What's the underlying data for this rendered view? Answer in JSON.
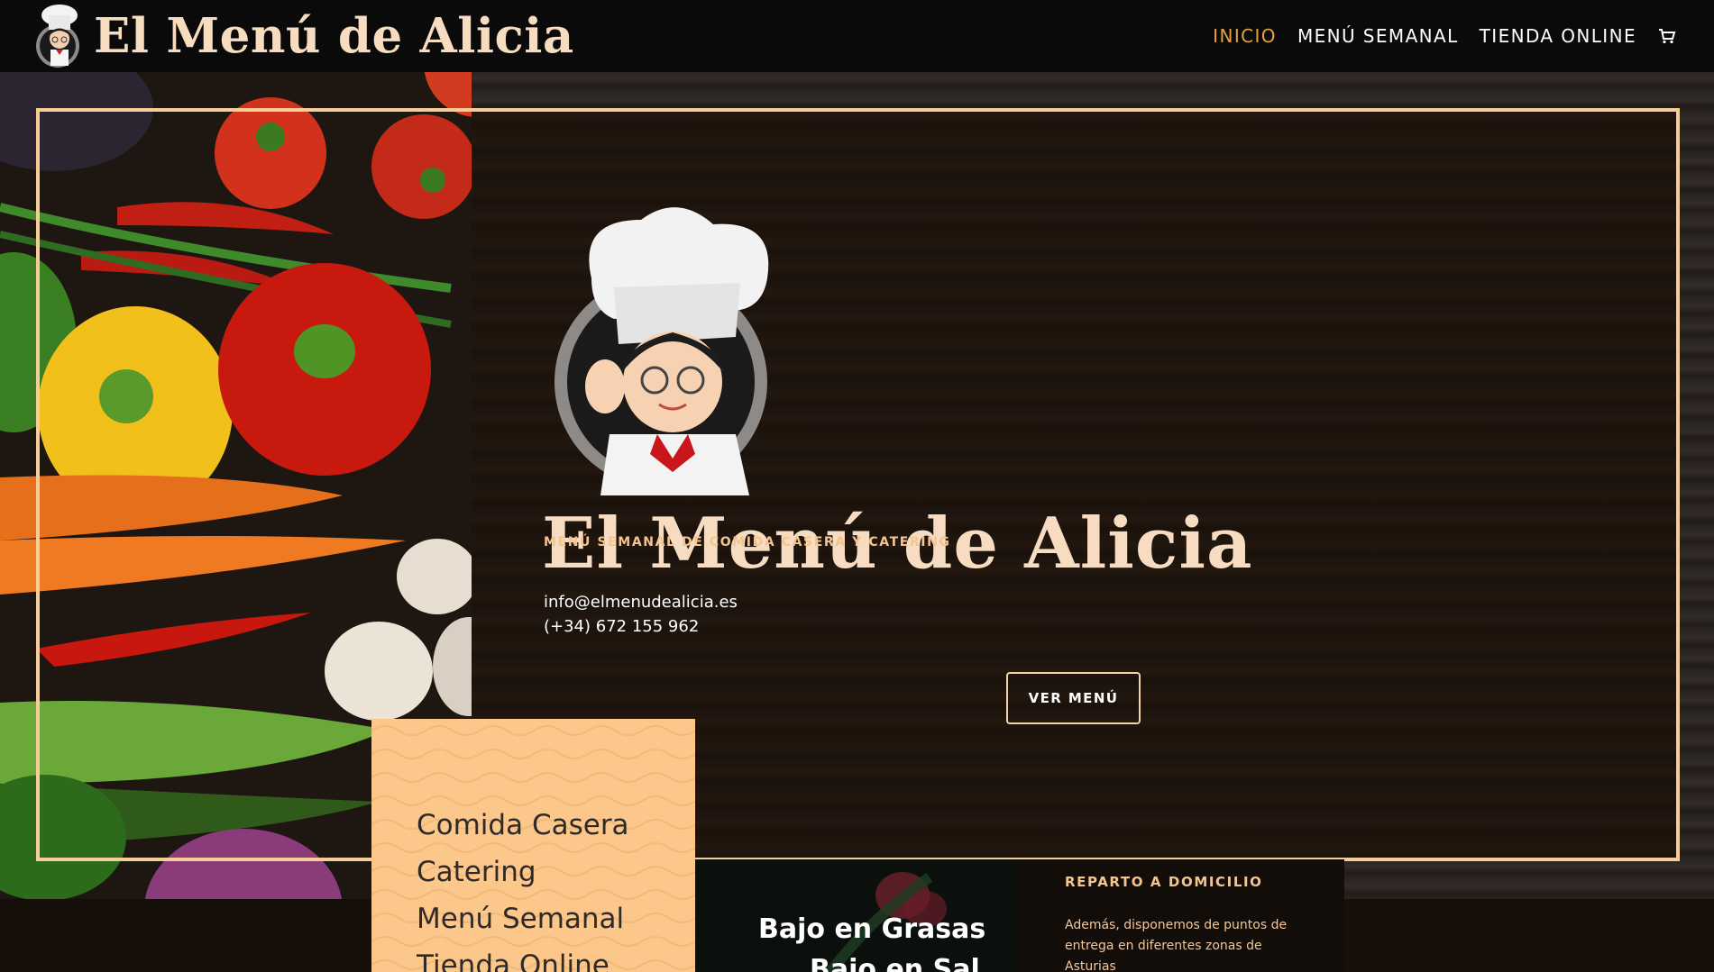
{
  "header": {
    "logo_text": "El Menú de Alicia",
    "nav": [
      {
        "label": "INICIO",
        "active": true
      },
      {
        "label": "MENÚ SEMANAL",
        "active": false
      },
      {
        "label": "TIENDA ONLINE",
        "active": false
      }
    ],
    "cart_icon": "cart-icon"
  },
  "hero": {
    "title": "El Menú de Alicia",
    "subtitle": "MENÚ SEMANAL DE COMIDA CASERA Y CATERING",
    "email": "info@elmenudealicia.es",
    "phone": "(+34) 672 155 962",
    "button_label": "VER MENÚ"
  },
  "services_card": {
    "items": [
      "Comida Casera",
      "Catering",
      "Menú Semanal",
      "Tienda Online"
    ]
  },
  "feature_card": {
    "line1": "Bajo en Grasas",
    "line2": "Bajo en Sal"
  },
  "delivery_card": {
    "title": "REPARTO A DOMICILIO",
    "description": "Además, disponemos de puntos de entrega en diferentes zonas de Asturias"
  },
  "colors": {
    "header_bg": "#0a0a0a",
    "accent_gold": "#e3a33b",
    "frame_gold": "#f6cd96",
    "title_cream": "#f8dcc2",
    "peach_card": "#fcc78b"
  }
}
